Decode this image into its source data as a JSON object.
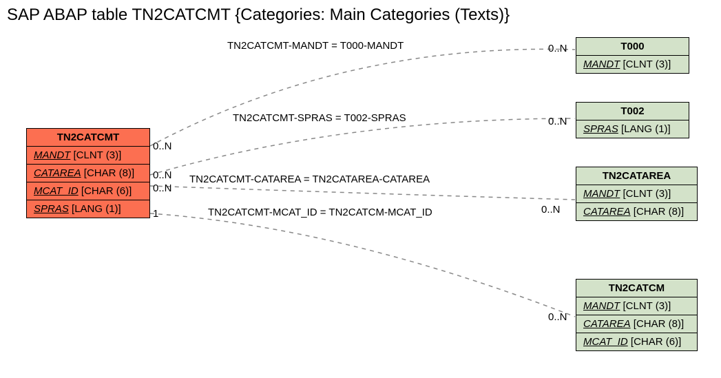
{
  "title": "SAP ABAP table TN2CATCMT {Categories: Main Categories (Texts)}",
  "main_entity": {
    "name": "TN2CATCMT",
    "fields": [
      {
        "name": "MANDT",
        "type": "[CLNT (3)]"
      },
      {
        "name": "CATAREA",
        "type": "[CHAR (8)]"
      },
      {
        "name": "MCAT_ID",
        "type": "[CHAR (6)]"
      },
      {
        "name": "SPRAS",
        "type": "[LANG (1)]"
      }
    ]
  },
  "related": {
    "T000": {
      "name": "T000",
      "fields": [
        {
          "name": "MANDT",
          "type": "[CLNT (3)]"
        }
      ]
    },
    "T002": {
      "name": "T002",
      "fields": [
        {
          "name": "SPRAS",
          "type": "[LANG (1)]"
        }
      ]
    },
    "TN2CATAREA": {
      "name": "TN2CATAREA",
      "fields": [
        {
          "name": "MANDT",
          "type": "[CLNT (3)]"
        },
        {
          "name": "CATAREA",
          "type": "[CHAR (8)]"
        }
      ]
    },
    "TN2CATCM": {
      "name": "TN2CATCM",
      "fields": [
        {
          "name": "MANDT",
          "type": "[CLNT (3)]"
        },
        {
          "name": "CATAREA",
          "type": "[CHAR (8)]"
        },
        {
          "name": "MCAT_ID",
          "type": "[CHAR (6)]"
        }
      ]
    }
  },
  "relations": {
    "r1": {
      "label": "TN2CATCMT-MANDT = T000-MANDT",
      "left_card": "0..N",
      "right_card": "0..N"
    },
    "r2": {
      "label": "TN2CATCMT-SPRAS = T002-SPRAS",
      "left_card": "0..N",
      "right_card": "0..N"
    },
    "r3": {
      "label": "TN2CATCMT-CATAREA = TN2CATAREA-CATAREA",
      "left_card": "0..N",
      "right_card": "0..N"
    },
    "r4": {
      "label": "TN2CATCMT-MCAT_ID = TN2CATCM-MCAT_ID",
      "left_card": "1",
      "right_card": "0..N"
    }
  }
}
